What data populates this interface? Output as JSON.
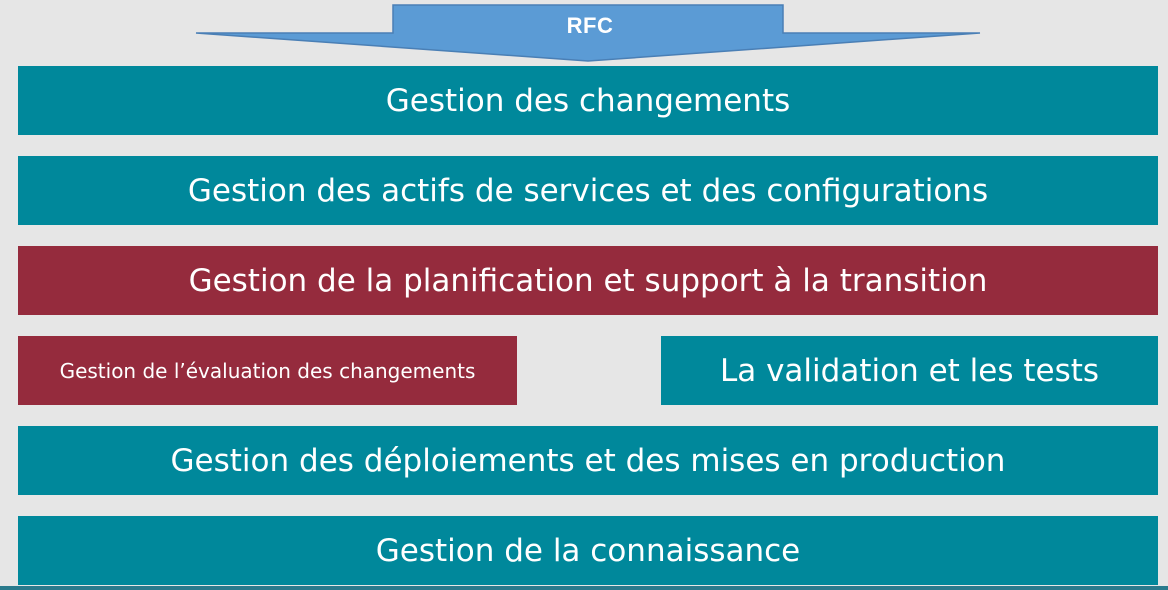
{
  "arrow": {
    "label": "RFC"
  },
  "boxes": {
    "change_management": "Gestion des changements",
    "service_asset_config": "Gestion des actifs de services et des configurations",
    "transition_planning": "Gestion de la planification et support à la transition",
    "change_evaluation": "Gestion de l’évaluation des changements",
    "validation_testing": "La validation et les tests",
    "release_deployment": "Gestion des déploiements et des mises en production",
    "knowledge_management": "Gestion de la connaissance"
  },
  "colors": {
    "background": "#e6e6e6",
    "teal": "#00889b",
    "maroon": "#952b3d",
    "arrow_fill": "#5b9bd5",
    "arrow_stroke": "#4a7fb5"
  }
}
